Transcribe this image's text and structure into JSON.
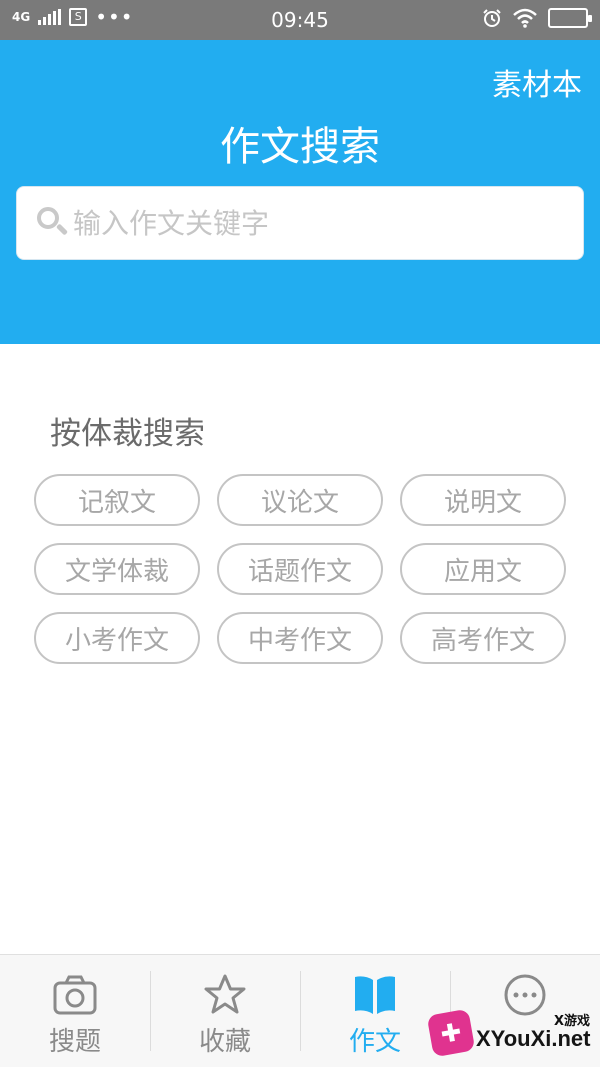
{
  "status_bar": {
    "network": "4G",
    "sim_label": "S",
    "more": "•••",
    "time": "09:45",
    "icons": [
      "signal-icon",
      "sim-icon",
      "alarm-icon",
      "wifi-icon",
      "battery-icon"
    ]
  },
  "header": {
    "link_label": "素材本",
    "title": "作文搜索",
    "search_placeholder": "输入作文关键字",
    "background_color": "#22adf0"
  },
  "section": {
    "title": "按体裁搜索",
    "genres": [
      "记叙文",
      "议论文",
      "说明文",
      "文学体裁",
      "话题作文",
      "应用文",
      "小考作文",
      "中考作文",
      "高考作文"
    ]
  },
  "bottom_nav": {
    "items": [
      {
        "label": "搜题",
        "icon": "camera-icon",
        "active": false
      },
      {
        "label": "收藏",
        "icon": "star-icon",
        "active": false
      },
      {
        "label": "作文",
        "icon": "book-icon",
        "active": true
      },
      {
        "label": "",
        "icon": "more-icon",
        "active": false
      }
    ],
    "active_color": "#22adf0",
    "inactive_color": "#8a8a8a"
  },
  "watermark": {
    "small_text": "X游戏",
    "text": "XYouXi.net"
  }
}
